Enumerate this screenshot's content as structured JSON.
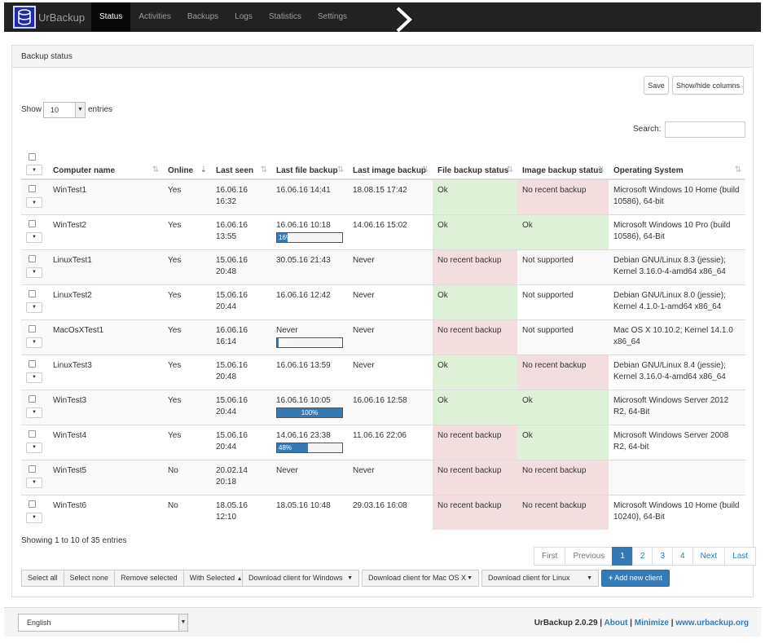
{
  "app": {
    "brand": "UrBackup"
  },
  "nav": [
    {
      "label": "Status",
      "active": true
    },
    {
      "label": "Activities"
    },
    {
      "label": "Backups"
    },
    {
      "label": "Logs"
    },
    {
      "label": "Statistics"
    },
    {
      "label": "Settings"
    }
  ],
  "panel": {
    "title": "Backup status"
  },
  "buttons": {
    "save": "Save",
    "show_hide_columns": "Show/hide columns"
  },
  "length": {
    "show": "Show",
    "value": "10",
    "entries": "entries"
  },
  "search": {
    "label": "Search:",
    "value": ""
  },
  "columns": {
    "computer_name": "Computer name",
    "online": "Online",
    "last_seen": "Last seen",
    "last_file_backup": "Last file backup",
    "last_image_backup": "Last image backup",
    "file_backup_status": "File backup status",
    "image_backup_status": "Image backup status",
    "os": "Operating System"
  },
  "rows": [
    {
      "name": "WinTest1",
      "online": "Yes",
      "seen": "16.06.16 16:32",
      "file_backup": "16.06.16 14:41",
      "progress": null,
      "image_backup": "18.08.15 17:42",
      "file_status": "Ok",
      "file_ok": true,
      "image_status": "No recent backup",
      "image_ok": false,
      "os": "Microsoft Windows 10 Home (build 10586), 64-bit"
    },
    {
      "name": "WinTest2",
      "online": "Yes",
      "seen": "16.06.16 13:55",
      "file_backup": "16.06.16 10:18",
      "progress": {
        "value": 0.16,
        "label": "16%"
      },
      "image_backup": "14.06.16 15:02",
      "file_status": "Ok",
      "file_ok": true,
      "image_status": "Ok",
      "image_ok": true,
      "os": "Microsoft Windows 10 Pro (build 10586), 64-Bit"
    },
    {
      "name": "LinuxTest1",
      "online": "Yes",
      "seen": "15.06.16 20:48",
      "file_backup": "30.05.16 21:43",
      "progress": null,
      "image_backup": "Never",
      "file_status": "No recent backup",
      "file_ok": false,
      "image_status": "Not supported",
      "image_ok": null,
      "os": "Debian GNU/Linux 8.3 (jessie); Kernel 3.16.0-4-amd64 x86_64"
    },
    {
      "name": "LinuxTest2",
      "online": "Yes",
      "seen": "15.06.16 20:44",
      "file_backup": "16.06.16 12:42",
      "progress": null,
      "image_backup": "Never",
      "file_status": "Ok",
      "file_ok": true,
      "image_status": "Not supported",
      "image_ok": null,
      "os": "Debian GNU/Linux 8.0 (jessie); Kernel 4.1.0-1-amd64 x86_64"
    },
    {
      "name": "MacOsXTest1",
      "online": "Yes",
      "seen": "16.06.16 16:14",
      "file_backup": "Never",
      "progress": {
        "value": 0.0,
        "label": "0%"
      },
      "image_backup": "Never",
      "file_status": "No recent backup",
      "file_ok": false,
      "image_status": "Not supported",
      "image_ok": null,
      "os": "Mac OS X 10.10.2; Kernel 14.1.0 x86_64"
    },
    {
      "name": "LinuxTest3",
      "online": "Yes",
      "seen": "15.06.16 20:48",
      "file_backup": "16.06.16 13:59",
      "progress": null,
      "image_backup": "Never",
      "file_status": "Ok",
      "file_ok": true,
      "image_status": "No recent backup",
      "image_ok": false,
      "os": "Debian GNU/Linux 8.4 (jessie); Kernel 3.16.0-4-amd64 x86_64"
    },
    {
      "name": "WinTest3",
      "online": "Yes",
      "seen": "15.06.16 20:44",
      "file_backup": "16.06.16 10:05",
      "progress": {
        "value": 1.0,
        "label": "100%"
      },
      "image_backup": "16.06.16 12:58",
      "file_status": "Ok",
      "file_ok": true,
      "image_status": "Ok",
      "image_ok": true,
      "os": "Microsoft Windows Server 2012 R2, 64-Bit"
    },
    {
      "name": "WinTest4",
      "online": "Yes",
      "seen": "15.06.16 20:44",
      "file_backup": "14.06.16 23:38",
      "progress": {
        "value": 0.48,
        "label": "48%"
      },
      "image_backup": "11.06.16 22:06",
      "file_status": "No recent backup",
      "file_ok": false,
      "image_status": "Ok",
      "image_ok": true,
      "os": "Microsoft Windows Server 2008 R2, 64-bit"
    },
    {
      "name": "WinTest5",
      "online": "No",
      "seen": "20.02.14 20:18",
      "file_backup": "Never",
      "progress": null,
      "image_backup": "Never",
      "file_status": "No recent backup",
      "file_ok": false,
      "image_status": "No recent backup",
      "image_ok": false,
      "os": ""
    },
    {
      "name": "WinTest6",
      "online": "No",
      "seen": "18.05.16 12:10",
      "file_backup": "18.05.16 10:48",
      "progress": null,
      "image_backup": "29.03.16 16:08",
      "file_status": "No recent backup",
      "file_ok": false,
      "image_status": "No recent backup",
      "image_ok": false,
      "os": "Microsoft Windows 10 Home (build 10240), 64-Bit"
    }
  ],
  "info": "Showing 1 to 10 of 35 entries",
  "pagination": {
    "first": "First",
    "previous": "Previous",
    "pages": [
      "1",
      "2",
      "3",
      "4"
    ],
    "current": "1",
    "next": "Next",
    "last": "Last"
  },
  "toolbar": {
    "select_all": "Select all",
    "select_none": "Select none",
    "remove_selected": "Remove selected",
    "with_selected": "With Selected",
    "download_windows": "Download client for Windows",
    "download_mac": "Download client for Mac OS X",
    "download_linux": "Download client for Linux",
    "add_client": "Add new client"
  },
  "footer": {
    "language": "English",
    "version": "UrBackup 2.0.29",
    "about": "About",
    "minimize": "Minimize",
    "site": "www.urbackup.org"
  },
  "colors": {
    "accent": "#337ab7",
    "ok": "#dff0d8",
    "bad": "#f2dede",
    "navbar": "#222222"
  }
}
